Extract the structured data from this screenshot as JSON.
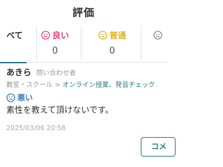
{
  "header": {
    "title": "評価"
  },
  "tabs": [
    {
      "label": "べて"
    },
    {
      "label": "良い",
      "count": "0",
      "color": "#e8467c"
    },
    {
      "label": "普通",
      "count": "0",
      "color": "#e6b422"
    },
    {
      "label": "",
      "color": "#8a8a8a"
    }
  ],
  "colors": {
    "accent": "#2d7f89",
    "bad": "#3b7dc4",
    "good": "#e8467c",
    "normal": "#e6b422"
  },
  "review": {
    "user_name": "あきら",
    "role": "問い合わせ者",
    "category": "教室・スクール",
    "separator": ">",
    "subcategory": "オンライン授業、発音チェック",
    "rating_label": "悪い",
    "comment": "素性を教えて頂けないです。",
    "date": "2025/03/06 20:58",
    "comment_button_label": "コメ"
  }
}
